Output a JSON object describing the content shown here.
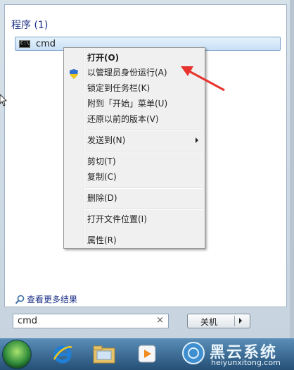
{
  "programs": {
    "title": "程序 (1)",
    "items": [
      {
        "label": "cmd",
        "icon": "cmd-icon"
      }
    ]
  },
  "context_menu": {
    "items": [
      {
        "label": "打开(O)",
        "bold": true
      },
      {
        "label": "以管理员身份运行(A)",
        "icon": "shield-icon"
      },
      {
        "label": "锁定到任务栏(K)"
      },
      {
        "label": "附到「开始」菜单(U)"
      },
      {
        "label": "还原以前的版本(V)"
      },
      {
        "label": "发送到(N)",
        "submenu": true
      },
      {
        "label": "剪切(T)"
      },
      {
        "label": "复制(C)"
      },
      {
        "label": "删除(D)"
      },
      {
        "label": "打开文件位置(I)"
      },
      {
        "label": "属性(R)"
      }
    ]
  },
  "see_more": {
    "label": "查看更多结果"
  },
  "search": {
    "value": "cmd"
  },
  "shutdown": {
    "label": "关机"
  },
  "watermark": {
    "title": "黑云系统",
    "url": "heiyunxitong.com"
  },
  "colors": {
    "accent_red": "#e8342f",
    "link_blue": "#1e3287",
    "selection_blue": "#c9e0f7"
  }
}
